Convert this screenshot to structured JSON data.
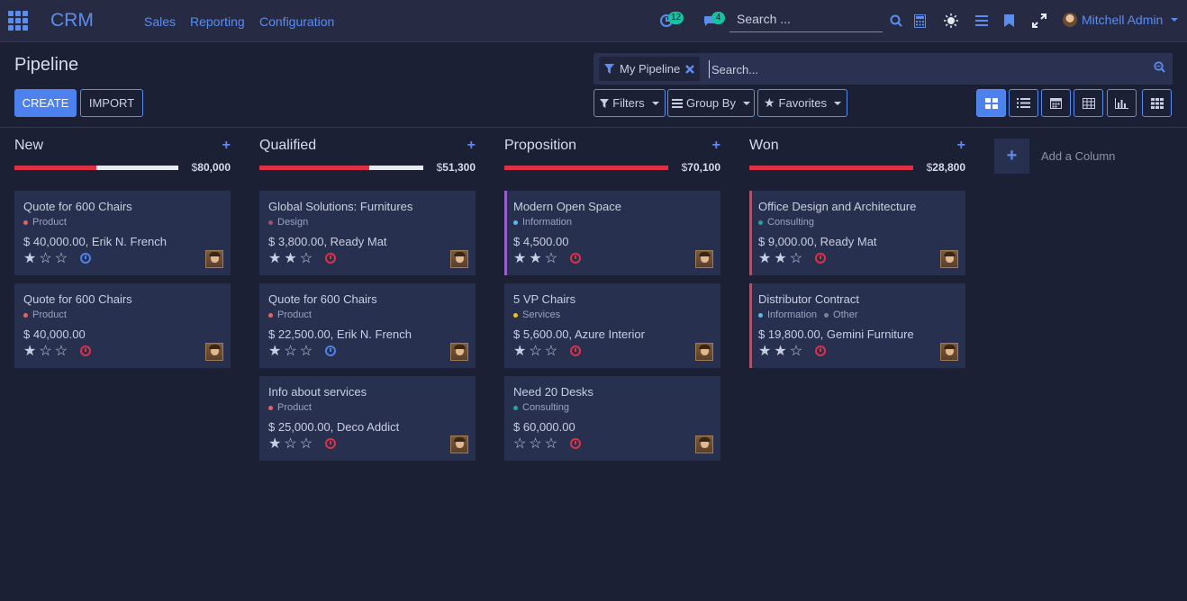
{
  "app": {
    "name": "CRM"
  },
  "nav": {
    "menus": [
      "Sales",
      "Reporting",
      "Configuration"
    ]
  },
  "systray": {
    "activity_count": "12",
    "messages_count": "4",
    "search_placeholder": "Search ...",
    "user_name": "Mitchell Admin"
  },
  "page": {
    "title": "Pipeline"
  },
  "buttons": {
    "create": "CREATE",
    "import": "IMPORT"
  },
  "search": {
    "facet_label": "My Pipeline",
    "placeholder": "Search...",
    "filters": "Filters",
    "group_by": "Group By",
    "favorites": "Favorites"
  },
  "views": [
    "kanban",
    "list",
    "calendar",
    "pivot",
    "graph",
    "activity"
  ],
  "colors": {
    "accent": "#4d82ee",
    "danger": "#dd3145",
    "success": "#1ac0a2"
  },
  "columns": [
    {
      "title": "New",
      "currency": "$",
      "total": "80,000",
      "progress_red": 0.5,
      "cards": [
        {
          "title": "Quote for 600 Chairs",
          "tags": [
            {
              "label": "Product",
              "color": "#e06464"
            }
          ],
          "value": "$ 40,000.00, Erik N. French",
          "stars": 1,
          "activity": "blue"
        },
        {
          "title": "Quote for 600 Chairs",
          "tags": [
            {
              "label": "Product",
              "color": "#e06464"
            }
          ],
          "value": "$ 40,000.00",
          "stars": 1,
          "activity": "red"
        }
      ]
    },
    {
      "title": "Qualified",
      "currency": "$",
      "total": "51,300",
      "progress_red": 0.67,
      "cards": [
        {
          "title": "Global Solutions: Furnitures",
          "tags": [
            {
              "label": "Design",
              "color": "#a05070"
            }
          ],
          "value": "$ 3,800.00, Ready Mat",
          "stars": 2,
          "activity": "red"
        },
        {
          "title": "Quote for 600 Chairs",
          "tags": [
            {
              "label": "Product",
              "color": "#e06464"
            }
          ],
          "value": "$ 22,500.00, Erik N. French",
          "stars": 1,
          "activity": "blue"
        },
        {
          "title": "Info about services",
          "tags": [
            {
              "label": "Product",
              "color": "#e06464"
            }
          ],
          "value": "$ 25,000.00, Deco Addict",
          "stars": 1,
          "activity": "red"
        }
      ]
    },
    {
      "title": "Proposition",
      "currency": "$",
      "total": "70,100",
      "progress_red": 1,
      "cards": [
        {
          "title": "Modern Open Space",
          "tags": [
            {
              "label": "Information",
              "color": "#5cb8e6"
            }
          ],
          "value": "$ 4,500.00",
          "stars": 2,
          "activity": "red",
          "accent": "purple"
        },
        {
          "title": "5 VP Chairs",
          "tags": [
            {
              "label": "Services",
              "color": "#f0c020"
            }
          ],
          "value": "$ 5,600.00, Azure Interior",
          "stars": 1,
          "activity": "red"
        },
        {
          "title": "Need 20 Desks",
          "tags": [
            {
              "label": "Consulting",
              "color": "#2aa198"
            }
          ],
          "value": "$ 60,000.00",
          "stars": 0,
          "activity": "red"
        }
      ]
    },
    {
      "title": "Won",
      "currency": "$",
      "total": "28,800",
      "progress_red": 1,
      "cards": [
        {
          "title": "Office Design and Architecture",
          "tags": [
            {
              "label": "Consulting",
              "color": "#2aa198"
            }
          ],
          "value": "$ 9,000.00, Ready Mat",
          "stars": 2,
          "activity": "red",
          "accent": "rose"
        },
        {
          "title": "Distributor Contract",
          "tags": [
            {
              "label": "Information",
              "color": "#5cb8e6"
            },
            {
              "label": "Other",
              "color": "#7a8298"
            }
          ],
          "value": "$ 19,800.00, Gemini Furniture",
          "stars": 2,
          "activity": "red",
          "accent": "rose"
        }
      ]
    }
  ],
  "add_column": {
    "label": "Add a Column"
  }
}
